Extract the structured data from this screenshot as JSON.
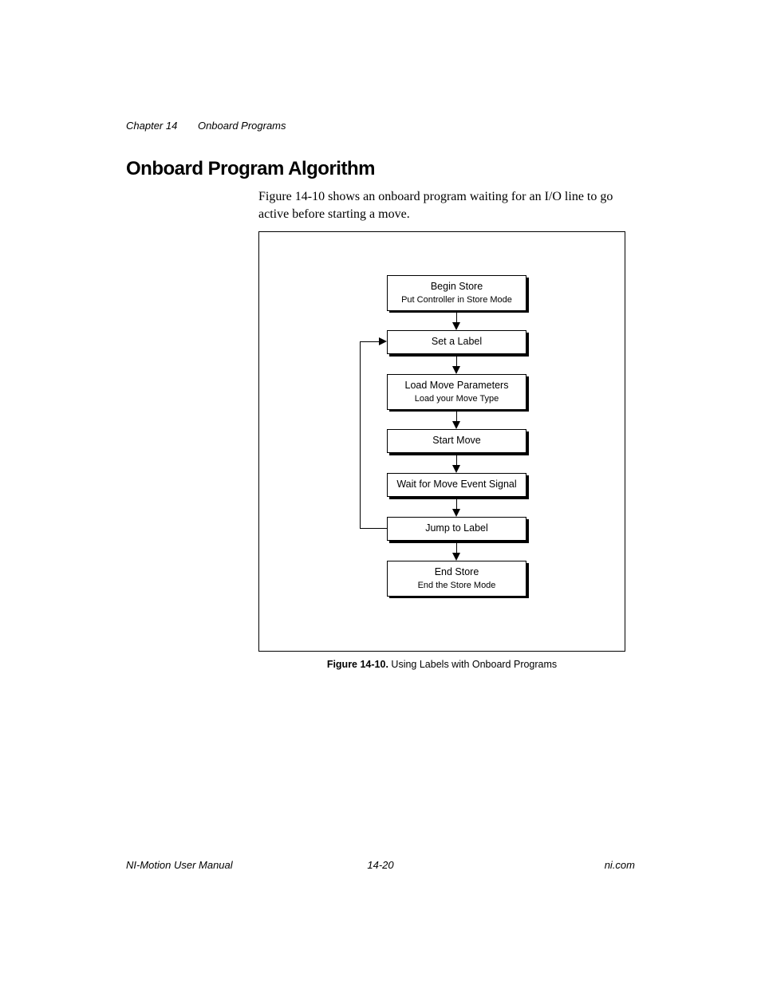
{
  "header": {
    "chapter_label": "Chapter 14",
    "chapter_title": "Onboard Programs"
  },
  "section_title": "Onboard Program Algorithm",
  "body_text": "Figure 14-10 shows an onboard program waiting for an I/O line to go active before starting a move.",
  "flowchart": {
    "nodes": [
      {
        "title": "Begin Store",
        "sub": "Put Controller in Store Mode"
      },
      {
        "title": "Set a Label",
        "sub": ""
      },
      {
        "title": "Load Move Parameters",
        "sub": "Load your Move Type"
      },
      {
        "title": "Start Move",
        "sub": ""
      },
      {
        "title": "Wait for Move Event Signal",
        "sub": ""
      },
      {
        "title": "Jump to Label",
        "sub": ""
      },
      {
        "title": "End Store",
        "sub": "End the Store Mode"
      }
    ]
  },
  "caption": {
    "label": "Figure 14-10.",
    "text": "Using Labels with Onboard Programs"
  },
  "footer": {
    "left": "NI-Motion User Manual",
    "center": "14-20",
    "right": "ni.com"
  }
}
